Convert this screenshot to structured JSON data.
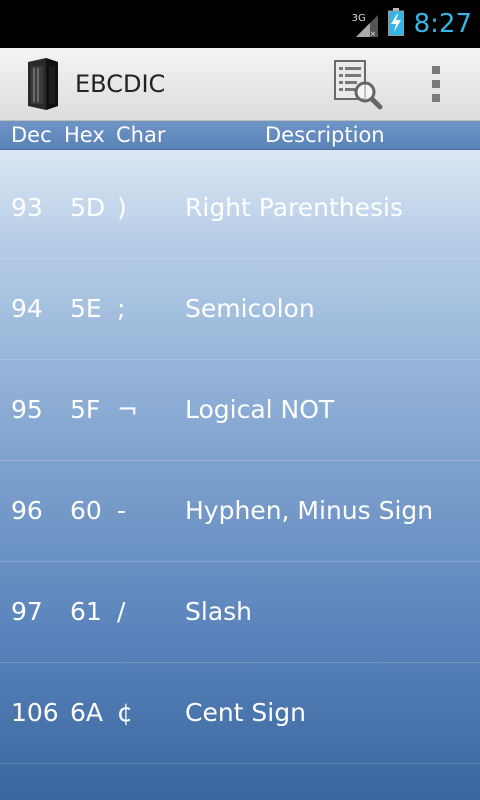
{
  "status_bar": {
    "network": "3G",
    "time": "8:27",
    "signal_icon": "signal-icon",
    "battery_icon": "battery-charging-icon"
  },
  "action_bar": {
    "title": "EBCDIC",
    "app_icon": "server-rack-icon",
    "search_icon": "document-search-icon",
    "overflow_icon": "overflow-menu-icon"
  },
  "table": {
    "headers": {
      "dec": "Dec",
      "hex": "Hex",
      "char": "Char",
      "description": "Description"
    },
    "rows": [
      {
        "dec": "93",
        "hex": "5D",
        "char": ")",
        "description": "Right Parenthesis"
      },
      {
        "dec": "94",
        "hex": "5E",
        "char": ";",
        "description": "Semicolon"
      },
      {
        "dec": "95",
        "hex": "5F",
        "char": "¬",
        "description": "Logical NOT"
      },
      {
        "dec": "96",
        "hex": "60",
        "char": "-",
        "description": "Hyphen, Minus Sign"
      },
      {
        "dec": "97",
        "hex": "61",
        "char": "/",
        "description": "Slash"
      },
      {
        "dec": "106",
        "hex": "6A",
        "char": "¢",
        "description": "Cent Sign"
      }
    ]
  },
  "colors": {
    "clock": "#33b5e5",
    "header_bg": "#5a82b8",
    "list_top": "#e6eef8",
    "list_bottom": "#3a679f"
  }
}
